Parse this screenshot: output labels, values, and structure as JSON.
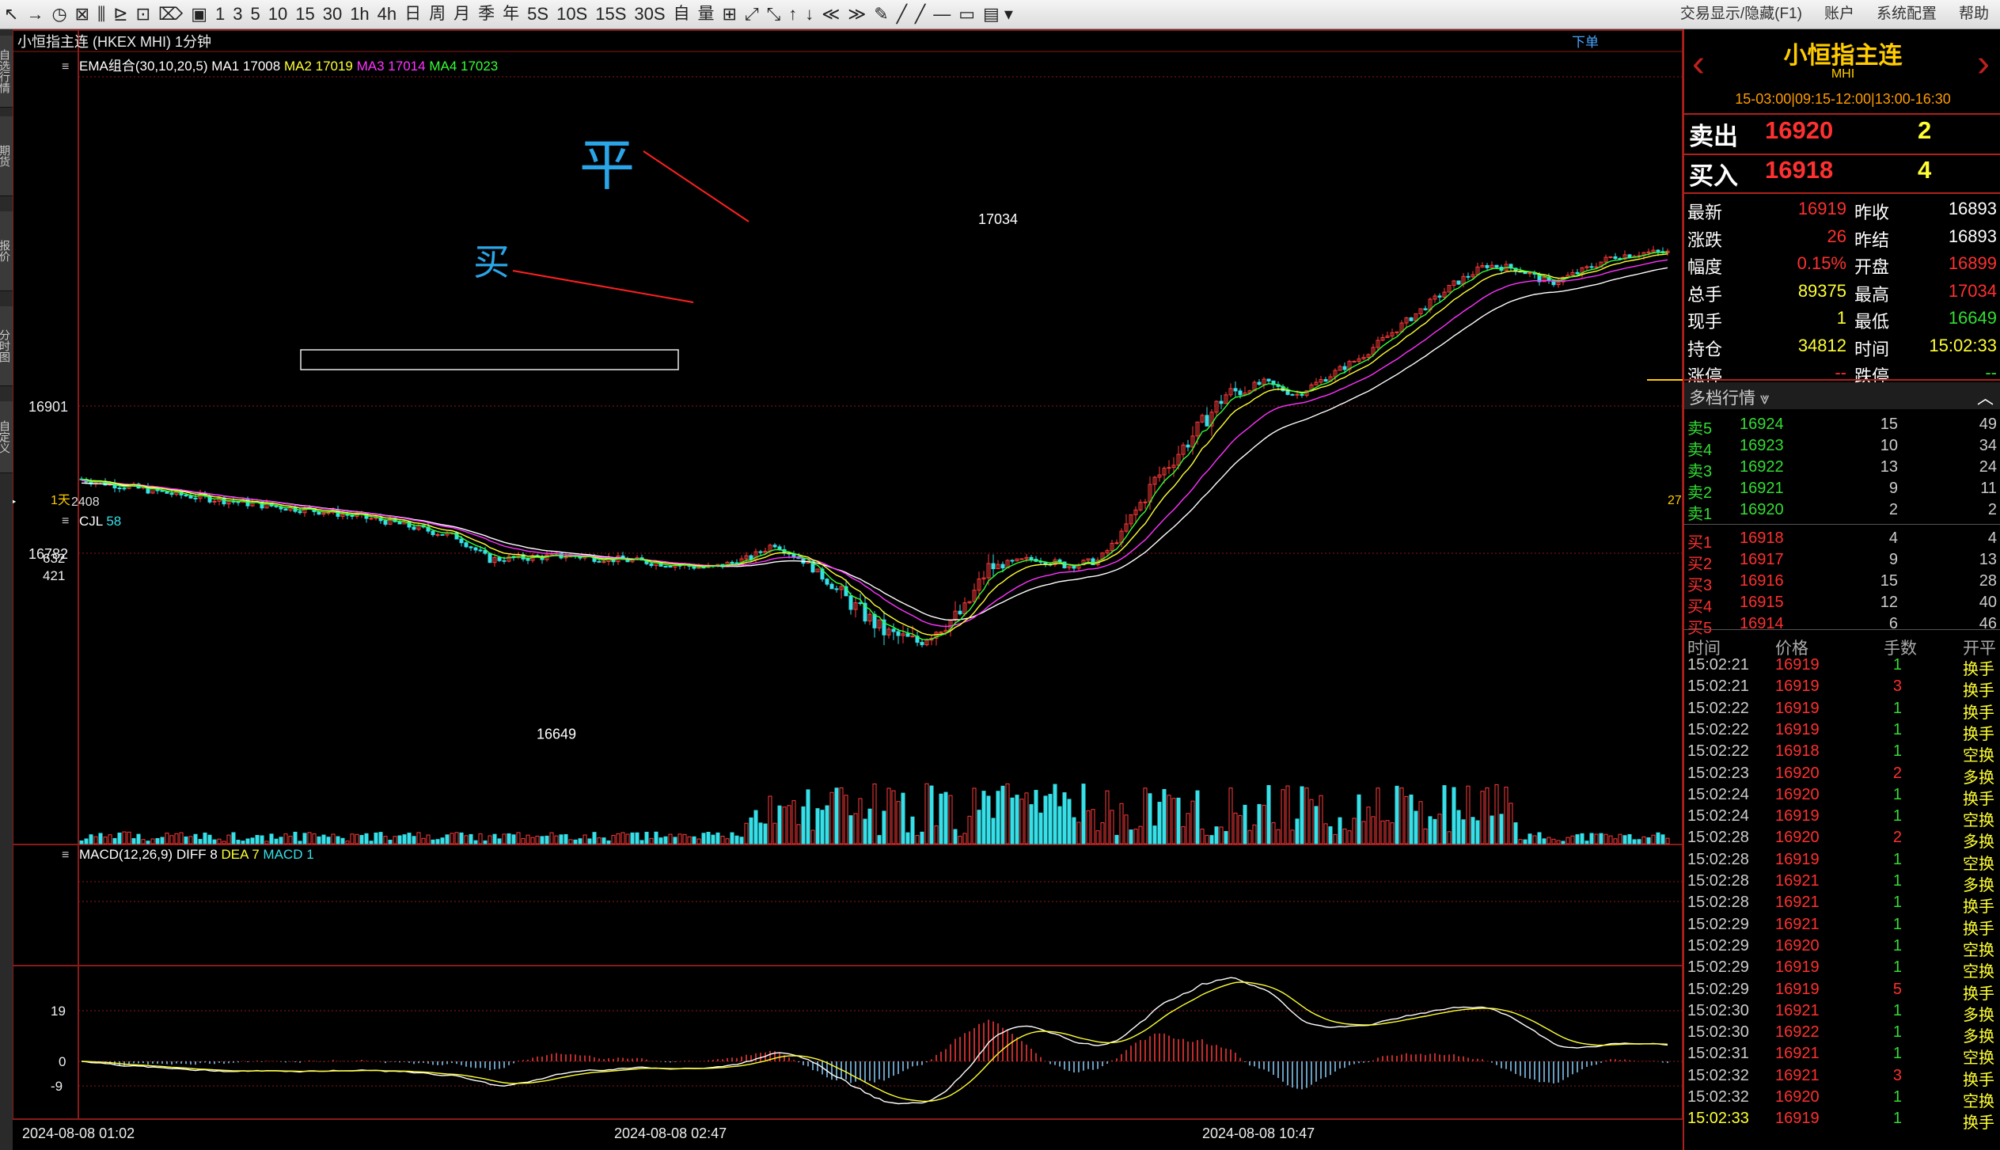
{
  "toolbar": {
    "items": [
      "↖",
      "→",
      "◷",
      "⊠",
      "⫼",
      "⊵",
      "⊡",
      "⌦",
      "▣",
      "1",
      "3",
      "5",
      "10",
      "15",
      "30",
      "1h",
      "4h",
      "日",
      "周",
      "月",
      "季",
      "年",
      "5S",
      "10S",
      "15S",
      "30S",
      "自",
      "量",
      "⊞",
      "⤢",
      "⤡",
      "↑",
      "↓",
      "≪",
      "≫",
      "✎",
      "╱",
      "╱",
      "—",
      "▭",
      "▤ ▾"
    ],
    "right": [
      "交易显示/隐藏(F1)",
      "账户",
      "系统配置",
      "帮助"
    ]
  },
  "left_tabs": [
    "自选行情",
    "期货",
    "报价",
    "分时图",
    "自定义"
  ],
  "chart": {
    "title": "小恒指主连 (HKEX MHI) 1分钟",
    "order_link": "下单",
    "ema_label": "EMA组合(30,10,20,5)",
    "ma1": "MA1 17008",
    "ma2": "MA2 17019",
    "ma3": "MA3 17014",
    "ma4": "MA4 17023",
    "price_ticks": [
      "16901",
      "16782"
    ],
    "high_label": "17034",
    "low_label": "16649",
    "period_tag": "1天",
    "contract_tag": "2408",
    "right_tag": "27",
    "annot_sell": "平",
    "annot_buy": "买",
    "vol_label": "CJL",
    "vol_value": "58",
    "vol_ticks": [
      "632",
      "421"
    ],
    "macd_label": "MACD(12,26,9)",
    "diff": "DIFF 8",
    "dea": "DEA 7",
    "macd_val": "MACD 1",
    "macd_ticks": [
      "19",
      "0",
      "-9"
    ],
    "time_labels": [
      "2024-08-08 01:02",
      "2024-08-08 02:47",
      "2024-08-08 10:47"
    ]
  },
  "panel": {
    "name": "小恒指主连",
    "code": "MHI",
    "hours": "15-03:00|09:15-12:00|13:00-16:30",
    "sell_label": "卖出",
    "sell_price": "16920",
    "sell_qty": "2",
    "buy_label": "买入",
    "buy_price": "16918",
    "buy_qty": "4",
    "stats": [
      [
        "最新",
        "16919",
        "昨收",
        "16893"
      ],
      [
        "涨跌",
        "26",
        "昨结",
        "16893"
      ],
      [
        "幅度",
        "0.15%",
        "开盘",
        "16899"
      ],
      [
        "总手",
        "89375",
        "最高",
        "17034"
      ],
      [
        "现手",
        "1",
        "最低",
        "16649"
      ],
      [
        "持仓",
        "34812",
        "时间",
        "15:02:33"
      ],
      [
        "涨停",
        "--",
        "跌停",
        "--"
      ]
    ],
    "depth_title": "多档行情 ⩔",
    "asks": [
      [
        "卖5",
        "16924",
        "15",
        "49"
      ],
      [
        "卖4",
        "16923",
        "10",
        "34"
      ],
      [
        "卖3",
        "16922",
        "13",
        "24"
      ],
      [
        "卖2",
        "16921",
        "9",
        "11"
      ],
      [
        "卖1",
        "16920",
        "2",
        "2"
      ]
    ],
    "bids": [
      [
        "买1",
        "16918",
        "4",
        "4"
      ],
      [
        "买2",
        "16917",
        "9",
        "13"
      ],
      [
        "买3",
        "16916",
        "15",
        "28"
      ],
      [
        "买4",
        "16915",
        "12",
        "40"
      ],
      [
        "买5",
        "16914",
        "6",
        "46"
      ]
    ],
    "tick_headers": [
      "时间",
      "价格",
      "手数",
      "开平"
    ],
    "ticks": [
      [
        "15:02:21",
        "16919",
        "1",
        "换手"
      ],
      [
        "15:02:21",
        "16919",
        "3",
        "换手"
      ],
      [
        "15:02:22",
        "16919",
        "1",
        "换手"
      ],
      [
        "15:02:22",
        "16919",
        "1",
        "换手"
      ],
      [
        "15:02:22",
        "16918",
        "1",
        "空换"
      ],
      [
        "15:02:23",
        "16920",
        "2",
        "多换"
      ],
      [
        "15:02:24",
        "16920",
        "1",
        "换手"
      ],
      [
        "15:02:24",
        "16919",
        "1",
        "空换"
      ],
      [
        "15:02:28",
        "16920",
        "2",
        "多换"
      ],
      [
        "15:02:28",
        "16919",
        "1",
        "空换"
      ],
      [
        "15:02:28",
        "16921",
        "1",
        "多换"
      ],
      [
        "15:02:28",
        "16921",
        "1",
        "换手"
      ],
      [
        "15:02:29",
        "16921",
        "1",
        "换手"
      ],
      [
        "15:02:29",
        "16920",
        "1",
        "空换"
      ],
      [
        "15:02:29",
        "16919",
        "1",
        "空换"
      ],
      [
        "15:02:29",
        "16919",
        "5",
        "换手"
      ],
      [
        "15:02:30",
        "16921",
        "1",
        "多换"
      ],
      [
        "15:02:30",
        "16922",
        "1",
        "多换"
      ],
      [
        "15:02:31",
        "16921",
        "1",
        "空换"
      ],
      [
        "15:02:32",
        "16921",
        "3",
        "换手"
      ],
      [
        "15:02:32",
        "16920",
        "1",
        "空换"
      ],
      [
        "15:02:33",
        "16919",
        "1",
        "换手"
      ]
    ]
  }
}
